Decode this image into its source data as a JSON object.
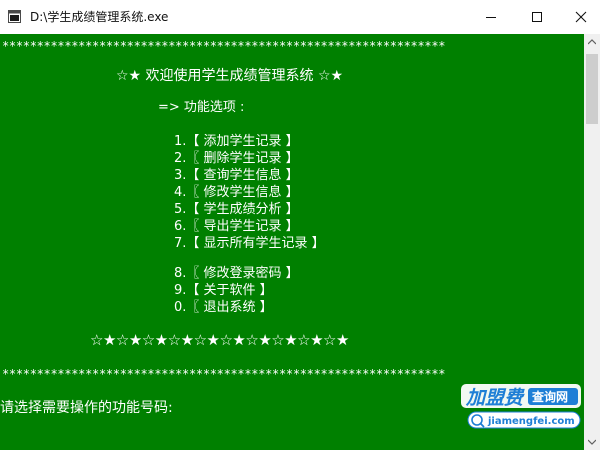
{
  "window": {
    "title": "D:\\学生成绩管理系统.exe"
  },
  "console": {
    "border_top": "****************************************************************",
    "welcome": "☆★ 欢迎使用学生成绩管理系统 ☆★",
    "menu_header": "=> 功能选项 :",
    "menu_items": [
      "1.【 添加学生记录 】",
      "2.〖 删除学生记录 】",
      "3.【 查询学生信息 】",
      "4.〖 修改学生信息 】",
      "5.【 学生成绩分析 】",
      "6.〖 导出学生记录 】",
      "7.【 显示所有学生记录 】",
      "8.〖 修改登录密码 】",
      "9.【 关于软件 】",
      "0.〖 退出系统 】"
    ],
    "star_line": "☆★☆★☆★☆★☆★☆★☆★☆★☆★☆★",
    "border_bottom": "****************************************************************",
    "prompt": "请选择需要操作的功能号码:"
  },
  "watermark": {
    "brand": "加盟费",
    "tag": "查询网",
    "url": "jiamengfei.com"
  },
  "colors": {
    "console_bg": "#008000",
    "console_text": "#ffffff",
    "watermark_blue": "#1e7fd6"
  }
}
